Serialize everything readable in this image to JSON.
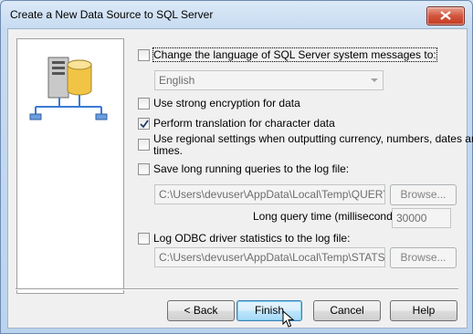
{
  "window": {
    "title": "Create a New Data Source to SQL Server"
  },
  "options": {
    "change_language": {
      "label": "Change the language of SQL Server system messages to:",
      "checked": false
    },
    "language_select": {
      "value": "English"
    },
    "strong_encryption": {
      "label": "Use strong encryption for data",
      "checked": false
    },
    "translation": {
      "label": "Perform translation for character data",
      "checked": true
    },
    "regional_settings": {
      "label_line1": "Use regional settings when outputting currency, numbers, dates and",
      "label_line2": "times.",
      "checked": false
    },
    "long_queries": {
      "label": "Save long running queries to the log file:",
      "checked": false
    },
    "long_queries_path": "C:\\Users\\devuser\\AppData\\Local\\Temp\\QUERY.L",
    "long_queries_browse": "Browse...",
    "long_query_time_label": "Long query time (milliseconds):",
    "long_query_time_value": "30000",
    "odbc_stats": {
      "label": "Log ODBC driver statistics to the log file:",
      "checked": false
    },
    "odbc_stats_path": "C:\\Users\\devuser\\AppData\\Local\\Temp\\STATS.LI",
    "odbc_stats_browse": "Browse..."
  },
  "buttons": {
    "back": "< Back",
    "finish": "Finish",
    "cancel": "Cancel",
    "help": "Help"
  },
  "icons": [
    "close-icon",
    "database-server-icon",
    "checkmark-icon",
    "dropdown-arrow-icon",
    "mouse-cursor-icon"
  ]
}
